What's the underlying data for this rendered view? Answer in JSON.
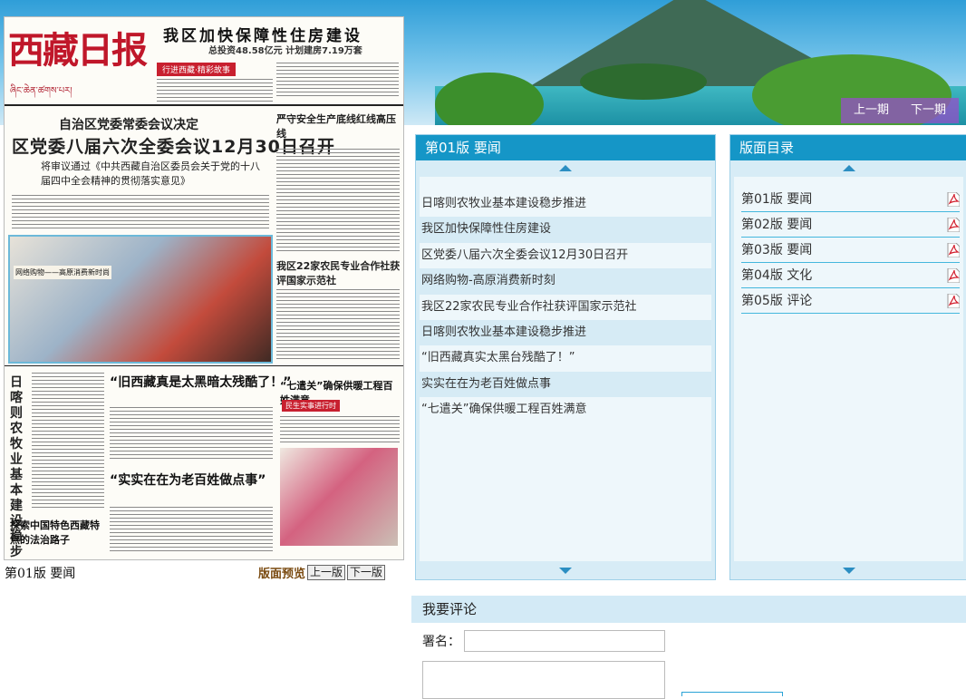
{
  "banner": {
    "prev_label": "上一期",
    "next_label": "下一期"
  },
  "paper": {
    "masthead": "西藏日报",
    "tibetan": "ཞིང་ཆེན་ཚགས་པར།",
    "top_headline": "我区加快保障性住房建设",
    "top_sub": "总投资48.58亿元 计划建房7.19万套",
    "top_tag": "行进西藏·精彩故事",
    "lead_kicker": "自治区党委常委会议决定",
    "lead_headline": "区党委八届六次全委会议12月30日召开",
    "lead_deck": "将审议通过《中共西藏自治区委员会关于党的十八届四中全会精神的贯彻落实意见》",
    "side_headline_1": "严守安全生产底线红线高压线",
    "side_headline_2": "我区22家农民专业合作社获评国家示范社",
    "photo_caption": "网络购物——高原消费新时尚",
    "vertical_headline": "日喀则农牧业基本建设稳步推进",
    "mid_headline": "“旧西藏真是太黑暗太残酷了！”",
    "right_headline": "“七遣关”确保供暖工程百姓满意",
    "red_tag": "民生实事进行时",
    "bottom_headline": "“实实在在为老百姓做点事”",
    "bottom_left": "探索中国特色西藏特点的法治路子"
  },
  "paper_caption": "第01版 要闻",
  "preview": {
    "label": "版面预览",
    "prev": "上一版",
    "next": "下一版"
  },
  "news_panel": {
    "title": "第01版 要闻",
    "items": [
      "日喀则农牧业基本建设稳步推进",
      "我区加快保障性住房建设",
      "区党委八届六次全委会议12月30日召开",
      "网络购物-高原消费新时刻",
      "我区22家农民专业合作社获评国家示范社",
      "日喀则农牧业基本建设稳步推进",
      "“旧西藏真实太黑台残酷了！”",
      "实实在在为老百姓做点事",
      "“七遣关”确保供暖工程百姓满意"
    ]
  },
  "toc_panel": {
    "title": "版面目录",
    "items": [
      "第01版 要闻",
      "第02版 要闻",
      "第03版 要闻",
      "第04版 文化",
      "第05版 评论"
    ]
  },
  "comment": {
    "title": "我要评论",
    "name_label": "署名：",
    "name_value": "",
    "text_value": ""
  },
  "colors": {
    "header_blue": "#1596c7",
    "panel_bg": "#d7ecf6",
    "accent_red": "#c8202f"
  },
  "icons": {
    "pdf": "pdf-icon",
    "scroll_up": "triangle-up-icon",
    "scroll_down": "triangle-down-icon"
  }
}
